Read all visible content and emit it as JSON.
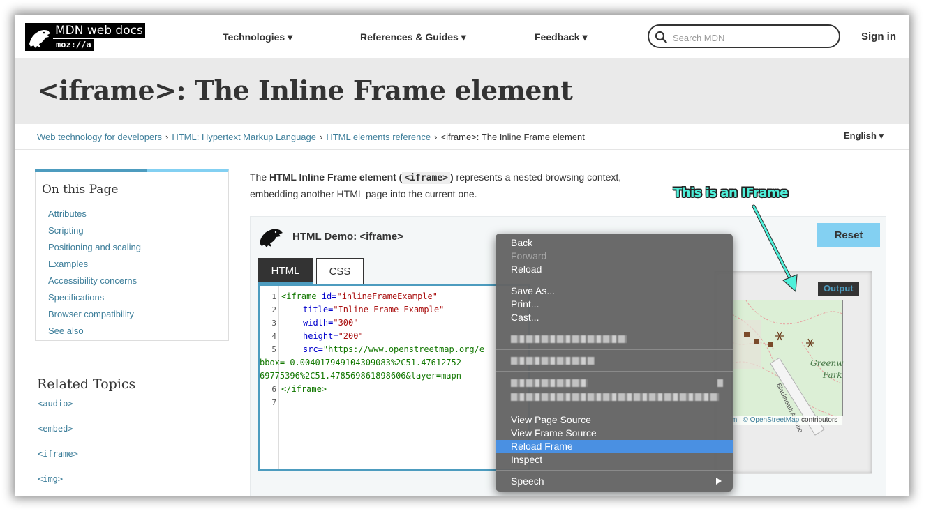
{
  "header": {
    "logo_title": "MDN web docs",
    "logo_sub": "moz://a",
    "nav": [
      "Technologies ▾",
      "References & Guides ▾",
      "Feedback ▾"
    ],
    "search_placeholder": "Search MDN",
    "sign_in": "Sign in"
  },
  "page_title": "<iframe>: The Inline Frame element",
  "breadcrumb": {
    "items": [
      "Web technology for developers",
      "HTML: Hypertext Markup Language",
      "HTML elements reference",
      "<iframe>: The Inline Frame element"
    ],
    "separator": "›"
  },
  "language": "English ▾",
  "toc": {
    "heading": "On this Page",
    "items": [
      "Attributes",
      "Scripting",
      "Positioning and scaling",
      "Examples",
      "Accessibility concerns",
      "Specifications",
      "Browser compatibility",
      "See also"
    ]
  },
  "related": {
    "heading": "Related Topics",
    "items": [
      "<audio>",
      "<embed>",
      "<iframe>",
      "<img>"
    ]
  },
  "intro": {
    "t1": "The ",
    "bold": "HTML Inline Frame element (",
    "code": "<iframe>",
    "bold_end": ")",
    "t2": " represents a nested ",
    "link": "browsing context",
    "t3": ",",
    "t4": "embedding another HTML page into the current one."
  },
  "demo": {
    "title": "HTML Demo: <iframe>",
    "reset": "Reset",
    "tabs": [
      "HTML",
      "CSS"
    ],
    "output_label": "Output",
    "code_lines": {
      "l1": {
        "num": "1",
        "tag": "<iframe",
        "attr": " id=",
        "str": "\"inlineFrameExample\""
      },
      "l2": {
        "num": "2",
        "attr": "title=",
        "str": "\"Inline Frame Example\""
      },
      "l3": {
        "num": "3",
        "attr": "width=",
        "str": "\"300\""
      },
      "l4": {
        "num": "4",
        "attr": "height=",
        "str": "\"200\""
      },
      "l5": {
        "num": "5",
        "attr": "src=",
        "str": "\"https://www.openstreetmap.org/e"
      },
      "l5b": "bbox=-0.004017949104309083%2C51.47612752",
      "l5c": "69775396%2C51.478569861898606&layer=mapn",
      "l6": {
        "num": "6",
        "tag": "</iframe>"
      },
      "l7": {
        "num": "7"
      }
    }
  },
  "map": {
    "label1": "Greenw",
    "label2": "Park",
    "road": "Blackheath Avenue",
    "attrib_pre": "m | © ",
    "attrib_link": "OpenStreetMap",
    "attrib_post": " contributors"
  },
  "annotation": "This is an IFrame",
  "context_menu": {
    "back": "Back",
    "forward": "Forward",
    "reload": "Reload",
    "save_as": "Save As...",
    "print": "Print...",
    "cast": "Cast...",
    "view_page_source": "View Page Source",
    "view_frame_source": "View Frame Source",
    "reload_frame": "Reload Frame",
    "inspect": "Inspect",
    "speech": "Speech"
  },
  "colors": {
    "link": "#3d7e9a",
    "accent_blue": "#83d0f2",
    "tab_border": "#4d9cbf",
    "menu_highlight": "#4a90e2",
    "annotation": "#4ff0da"
  }
}
